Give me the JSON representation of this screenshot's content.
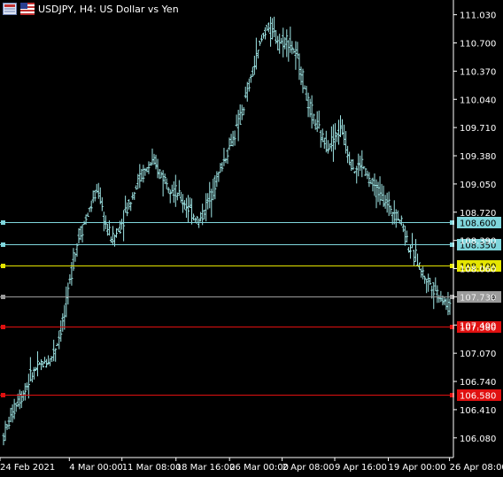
{
  "window": {
    "title": "USDJPY, H4:  US Dollar vs Yen"
  },
  "icons": {
    "period": "chart-period-icon",
    "flag": "currency-flag-icon"
  },
  "colors": {
    "background": "#000000",
    "bars": "#9fe6e6",
    "axis": "#ffffff",
    "cyan_line": "#7fd6dc",
    "yellow_line": "#e6e600",
    "gray_line": "#9b9b9b",
    "red_line": "#e01010"
  },
  "chart_data": {
    "type": "ohlc",
    "symbol": "USDJPY",
    "timeframe": "H4",
    "ylim": [
      105.85,
      111.14
    ],
    "y_ticks": [
      106.08,
      106.41,
      106.74,
      107.07,
      107.4,
      107.73,
      108.06,
      108.39,
      108.72,
      109.05,
      109.38,
      109.71,
      110.04,
      110.37,
      110.7,
      111.03
    ],
    "y_tick_labels": [
      "106.080",
      "106.410",
      "106.740",
      "107.070",
      "107.400",
      "107.730",
      "108.060",
      "108.390",
      "108.720",
      "109.050",
      "109.380",
      "109.710",
      "110.040",
      "110.370",
      "110.700",
      "111.030"
    ],
    "x_labels": [
      "24 Feb 2021",
      "4 Mar 00:00",
      "11 Mar 08:00",
      "18 Mar 16:00",
      "26 Mar 00:00",
      "2 Apr 08:00",
      "9 Apr 16:00",
      "19 Apr 00:00",
      "26 Apr 08:00"
    ],
    "x_label_fraction": [
      0.0,
      0.145,
      0.255,
      0.368,
      0.48,
      0.59,
      0.7,
      0.812,
      0.94
    ],
    "close_path": [
      106.1,
      106.3,
      106.5,
      106.6,
      106.8,
      106.9,
      106.95,
      107.0,
      107.2,
      107.5,
      108.0,
      108.4,
      108.6,
      108.8,
      109.0,
      108.6,
      108.4,
      108.5,
      108.7,
      108.9,
      109.1,
      109.2,
      109.3,
      109.2,
      109.1,
      109.0,
      108.9,
      108.8,
      108.7,
      108.6,
      108.8,
      109.0,
      109.2,
      109.4,
      109.6,
      109.8,
      110.1,
      110.4,
      110.7,
      110.9,
      110.8,
      110.7,
      110.75,
      110.6,
      110.4,
      110.0,
      109.8,
      109.6,
      109.5,
      109.6,
      109.7,
      109.4,
      109.2,
      109.3,
      109.1,
      109.0,
      108.9,
      108.8,
      108.7,
      108.6,
      108.3,
      108.2,
      108.0,
      107.9,
      107.8,
      107.7,
      107.6
    ],
    "levels": [
      {
        "value": 108.6,
        "label": "108.600",
        "color": "#7fd6dc",
        "text_color": "#000000"
      },
      {
        "value": 108.35,
        "label": "108.350",
        "color": "#7fd6dc",
        "text_color": "#000000"
      },
      {
        "value": 108.1,
        "label": "108.100",
        "color": "#e6e600",
        "text_color": "#000000"
      },
      {
        "value": 107.734,
        "label": "107.734",
        "color": "#9b9b9b",
        "text_color": "#000000"
      },
      {
        "value": 107.38,
        "label": "107.380",
        "color": "#e01010",
        "text_color": "#ffffff"
      },
      {
        "value": 106.58,
        "label": "106.580",
        "color": "#e01010",
        "text_color": "#ffffff"
      }
    ]
  }
}
